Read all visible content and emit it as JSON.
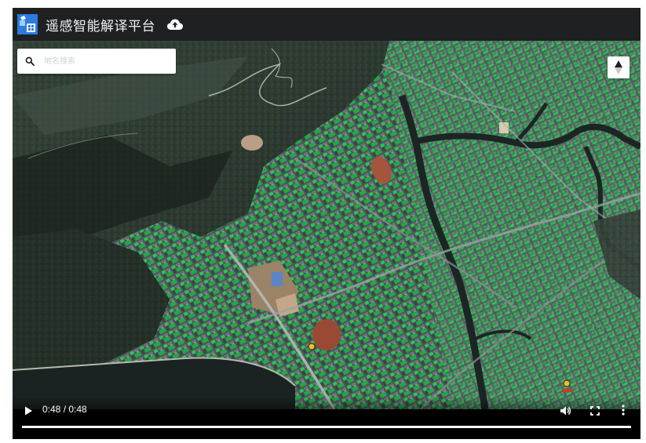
{
  "app": {
    "title": "遥感智能解译平台",
    "logo_icon": "satellite-logo-icon",
    "upload_icon": "cloud-upload-icon"
  },
  "search": {
    "placeholder": "地名搜索",
    "icon": "search-icon"
  },
  "map": {
    "type": "satellite-imagery",
    "compass_icon": "compass-north-icon"
  },
  "video": {
    "time_display": "0:48 / 0:48",
    "progress": 1.0,
    "play_icon": "play-icon",
    "volume_icon": "volume-icon",
    "fullscreen_icon": "fullscreen-icon",
    "more_icon": "more-vert-icon"
  },
  "colors": {
    "titlebar_bg": "#1f2022",
    "vegetation_green": "#2bb650",
    "urban_gray": "#5b6266",
    "river_dark": "#1c2524"
  }
}
